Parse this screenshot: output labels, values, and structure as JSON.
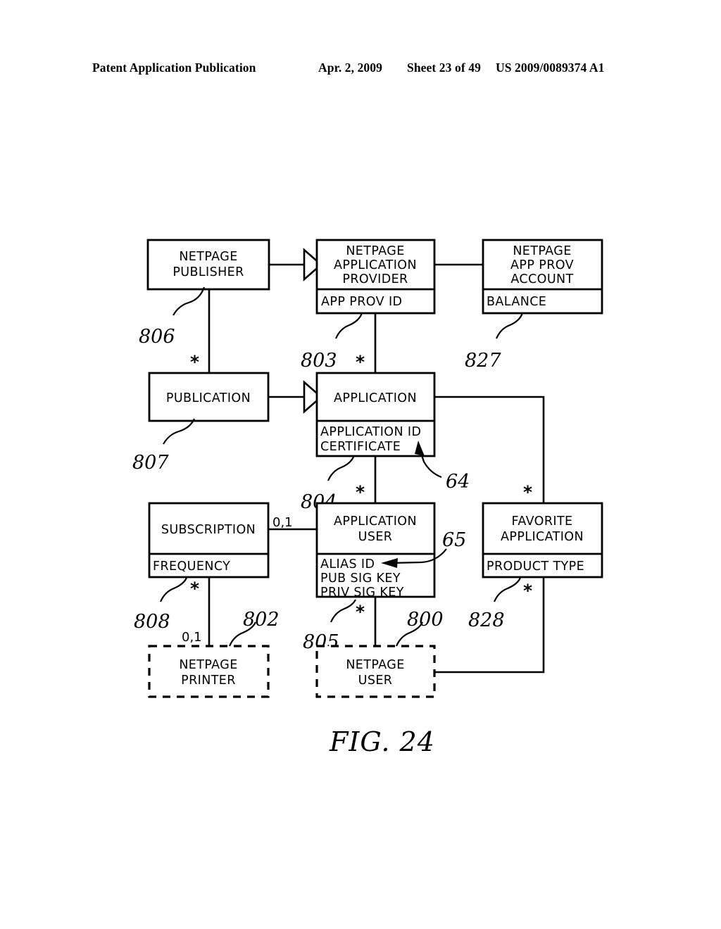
{
  "header": {
    "publication": "Patent Application Publication",
    "date": "Apr. 2, 2009",
    "sheet": "Sheet 23 of 49",
    "number": "US 2009/0089374 A1"
  },
  "figure": {
    "caption": "FIG. 24",
    "entities": [
      {
        "id": "netpage-publisher",
        "title_lines": [
          "NETPAGE",
          "PUBLISHER"
        ],
        "attributes": [],
        "ref": "806",
        "dashed": false
      },
      {
        "id": "netpage-application-provider",
        "title_lines": [
          "NETPAGE",
          "APPLICATION",
          "PROVIDER"
        ],
        "attributes": [
          "APP PROV ID"
        ],
        "ref": "803",
        "dashed": false
      },
      {
        "id": "netpage-app-prov-account",
        "title_lines": [
          "NETPAGE",
          "APP PROV",
          "ACCOUNT"
        ],
        "attributes": [
          "BALANCE"
        ],
        "ref": "827",
        "dashed": false
      },
      {
        "id": "publication",
        "title_lines": [
          "PUBLICATION"
        ],
        "attributes": [],
        "ref": "807",
        "dashed": false
      },
      {
        "id": "application",
        "title_lines": [
          "APPLICATION"
        ],
        "attributes": [
          "APPLICATION ID",
          "CERTIFICATE"
        ],
        "ref": "804",
        "dashed": false
      },
      {
        "id": "subscription",
        "title_lines": [
          "SUBSCRIPTION"
        ],
        "attributes": [
          "FREQUENCY"
        ],
        "ref": "808",
        "dashed": false
      },
      {
        "id": "application-user",
        "title_lines": [
          "APPLICATION",
          "USER"
        ],
        "attributes": [
          "ALIAS ID",
          "PUB SIG KEY",
          "PRIV SIG KEY"
        ],
        "ref": "805",
        "dashed": false
      },
      {
        "id": "favorite-application",
        "title_lines": [
          "FAVORITE",
          "APPLICATION"
        ],
        "attributes": [
          "PRODUCT TYPE"
        ],
        "ref": "828",
        "dashed": false
      },
      {
        "id": "netpage-printer",
        "title_lines": [
          "NETPAGE",
          "PRINTER"
        ],
        "attributes": [],
        "ref": "802",
        "dashed": true
      },
      {
        "id": "netpage-user",
        "title_lines": [
          "NETPAGE",
          "USER"
        ],
        "attributes": [],
        "ref": "800",
        "dashed": true
      }
    ],
    "callouts": [
      {
        "id": "callout-64",
        "label": "64",
        "points_to": "CERTIFICATE"
      },
      {
        "id": "callout-65",
        "label": "65",
        "points_to": "ALIAS ID"
      }
    ],
    "cardinalities": [
      {
        "id": "card-publisher-publication",
        "label": "*"
      },
      {
        "id": "card-provider-application",
        "label": "*"
      },
      {
        "id": "card-publication-up",
        "label": "*"
      },
      {
        "id": "card-application-up",
        "label": "*"
      },
      {
        "id": "card-application-appuser",
        "label": "*"
      },
      {
        "id": "card-appuser-up",
        "label": "*"
      },
      {
        "id": "card-application-favorite",
        "label": "*"
      },
      {
        "id": "card-favorite-down",
        "label": "*"
      },
      {
        "id": "card-subscription-printer",
        "label": "*"
      },
      {
        "id": "card-appuser-netpageuser",
        "label": "*"
      },
      {
        "id": "card-subscription-appuser",
        "label": "0,1"
      },
      {
        "id": "card-printer-link",
        "label": "0,1"
      }
    ],
    "colors": {
      "ink": "#000000",
      "paper": "#ffffff"
    }
  }
}
